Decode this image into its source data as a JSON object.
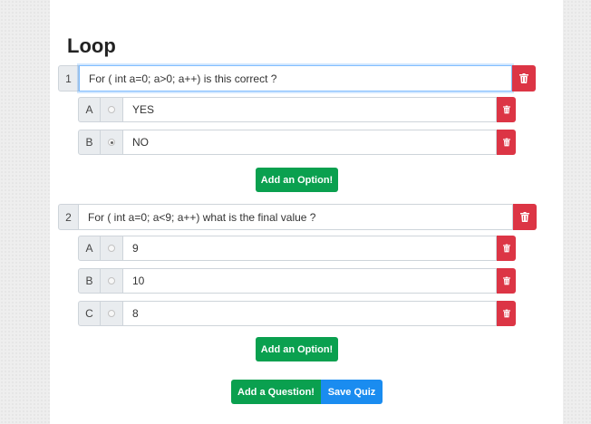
{
  "quiz": {
    "title": "Loop",
    "add_option_label": "Add an Option!",
    "add_question_label": "Add a Question!",
    "save_label": "Save Quiz",
    "questions": [
      {
        "number": "1",
        "text": "For ( int a=0; a>0; a++)  is this correct ?",
        "options": [
          {
            "letter": "A",
            "text": "YES",
            "selected": false
          },
          {
            "letter": "B",
            "text": "NO",
            "selected": true
          }
        ]
      },
      {
        "number": "2",
        "text": "For ( int a=0; a<9; a++)  what is the final value ?",
        "options": [
          {
            "letter": "A",
            "text": "9",
            "selected": false
          },
          {
            "letter": "B",
            "text": "10",
            "selected": false
          },
          {
            "letter": "C",
            "text": "8",
            "selected": false
          }
        ]
      }
    ]
  },
  "colors": {
    "danger": "#dc3545",
    "success": "#0aa04f",
    "primary": "#1a8cf0",
    "focus_border": "#80bdff"
  },
  "icons": {
    "delete": "trash-icon",
    "option_select": "radio-icon"
  }
}
